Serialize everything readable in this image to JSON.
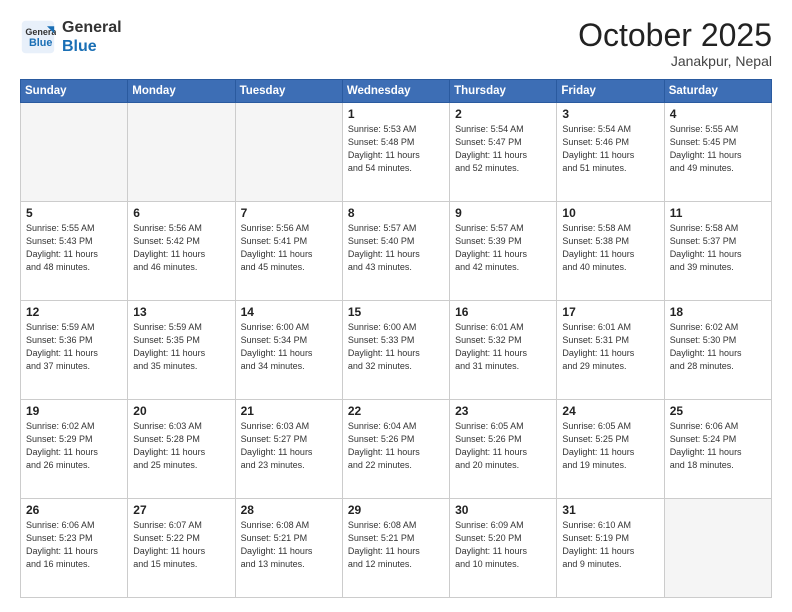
{
  "header": {
    "logo_line1": "General",
    "logo_line2": "Blue",
    "month": "October 2025",
    "location": "Janakpur, Nepal"
  },
  "weekdays": [
    "Sunday",
    "Monday",
    "Tuesday",
    "Wednesday",
    "Thursday",
    "Friday",
    "Saturday"
  ],
  "weeks": [
    [
      {
        "day": "",
        "info": "",
        "empty": true
      },
      {
        "day": "",
        "info": "",
        "empty": true
      },
      {
        "day": "",
        "info": "",
        "empty": true
      },
      {
        "day": "1",
        "info": "Sunrise: 5:53 AM\nSunset: 5:48 PM\nDaylight: 11 hours\nand 54 minutes."
      },
      {
        "day": "2",
        "info": "Sunrise: 5:54 AM\nSunset: 5:47 PM\nDaylight: 11 hours\nand 52 minutes."
      },
      {
        "day": "3",
        "info": "Sunrise: 5:54 AM\nSunset: 5:46 PM\nDaylight: 11 hours\nand 51 minutes."
      },
      {
        "day": "4",
        "info": "Sunrise: 5:55 AM\nSunset: 5:45 PM\nDaylight: 11 hours\nand 49 minutes."
      }
    ],
    [
      {
        "day": "5",
        "info": "Sunrise: 5:55 AM\nSunset: 5:43 PM\nDaylight: 11 hours\nand 48 minutes."
      },
      {
        "day": "6",
        "info": "Sunrise: 5:56 AM\nSunset: 5:42 PM\nDaylight: 11 hours\nand 46 minutes."
      },
      {
        "day": "7",
        "info": "Sunrise: 5:56 AM\nSunset: 5:41 PM\nDaylight: 11 hours\nand 45 minutes."
      },
      {
        "day": "8",
        "info": "Sunrise: 5:57 AM\nSunset: 5:40 PM\nDaylight: 11 hours\nand 43 minutes."
      },
      {
        "day": "9",
        "info": "Sunrise: 5:57 AM\nSunset: 5:39 PM\nDaylight: 11 hours\nand 42 minutes."
      },
      {
        "day": "10",
        "info": "Sunrise: 5:58 AM\nSunset: 5:38 PM\nDaylight: 11 hours\nand 40 minutes."
      },
      {
        "day": "11",
        "info": "Sunrise: 5:58 AM\nSunset: 5:37 PM\nDaylight: 11 hours\nand 39 minutes."
      }
    ],
    [
      {
        "day": "12",
        "info": "Sunrise: 5:59 AM\nSunset: 5:36 PM\nDaylight: 11 hours\nand 37 minutes."
      },
      {
        "day": "13",
        "info": "Sunrise: 5:59 AM\nSunset: 5:35 PM\nDaylight: 11 hours\nand 35 minutes."
      },
      {
        "day": "14",
        "info": "Sunrise: 6:00 AM\nSunset: 5:34 PM\nDaylight: 11 hours\nand 34 minutes."
      },
      {
        "day": "15",
        "info": "Sunrise: 6:00 AM\nSunset: 5:33 PM\nDaylight: 11 hours\nand 32 minutes."
      },
      {
        "day": "16",
        "info": "Sunrise: 6:01 AM\nSunset: 5:32 PM\nDaylight: 11 hours\nand 31 minutes."
      },
      {
        "day": "17",
        "info": "Sunrise: 6:01 AM\nSunset: 5:31 PM\nDaylight: 11 hours\nand 29 minutes."
      },
      {
        "day": "18",
        "info": "Sunrise: 6:02 AM\nSunset: 5:30 PM\nDaylight: 11 hours\nand 28 minutes."
      }
    ],
    [
      {
        "day": "19",
        "info": "Sunrise: 6:02 AM\nSunset: 5:29 PM\nDaylight: 11 hours\nand 26 minutes."
      },
      {
        "day": "20",
        "info": "Sunrise: 6:03 AM\nSunset: 5:28 PM\nDaylight: 11 hours\nand 25 minutes."
      },
      {
        "day": "21",
        "info": "Sunrise: 6:03 AM\nSunset: 5:27 PM\nDaylight: 11 hours\nand 23 minutes."
      },
      {
        "day": "22",
        "info": "Sunrise: 6:04 AM\nSunset: 5:26 PM\nDaylight: 11 hours\nand 22 minutes."
      },
      {
        "day": "23",
        "info": "Sunrise: 6:05 AM\nSunset: 5:26 PM\nDaylight: 11 hours\nand 20 minutes."
      },
      {
        "day": "24",
        "info": "Sunrise: 6:05 AM\nSunset: 5:25 PM\nDaylight: 11 hours\nand 19 minutes."
      },
      {
        "day": "25",
        "info": "Sunrise: 6:06 AM\nSunset: 5:24 PM\nDaylight: 11 hours\nand 18 minutes."
      }
    ],
    [
      {
        "day": "26",
        "info": "Sunrise: 6:06 AM\nSunset: 5:23 PM\nDaylight: 11 hours\nand 16 minutes."
      },
      {
        "day": "27",
        "info": "Sunrise: 6:07 AM\nSunset: 5:22 PM\nDaylight: 11 hours\nand 15 minutes."
      },
      {
        "day": "28",
        "info": "Sunrise: 6:08 AM\nSunset: 5:21 PM\nDaylight: 11 hours\nand 13 minutes."
      },
      {
        "day": "29",
        "info": "Sunrise: 6:08 AM\nSunset: 5:21 PM\nDaylight: 11 hours\nand 12 minutes."
      },
      {
        "day": "30",
        "info": "Sunrise: 6:09 AM\nSunset: 5:20 PM\nDaylight: 11 hours\nand 10 minutes."
      },
      {
        "day": "31",
        "info": "Sunrise: 6:10 AM\nSunset: 5:19 PM\nDaylight: 11 hours\nand 9 minutes."
      },
      {
        "day": "",
        "info": "",
        "empty": true
      }
    ]
  ]
}
